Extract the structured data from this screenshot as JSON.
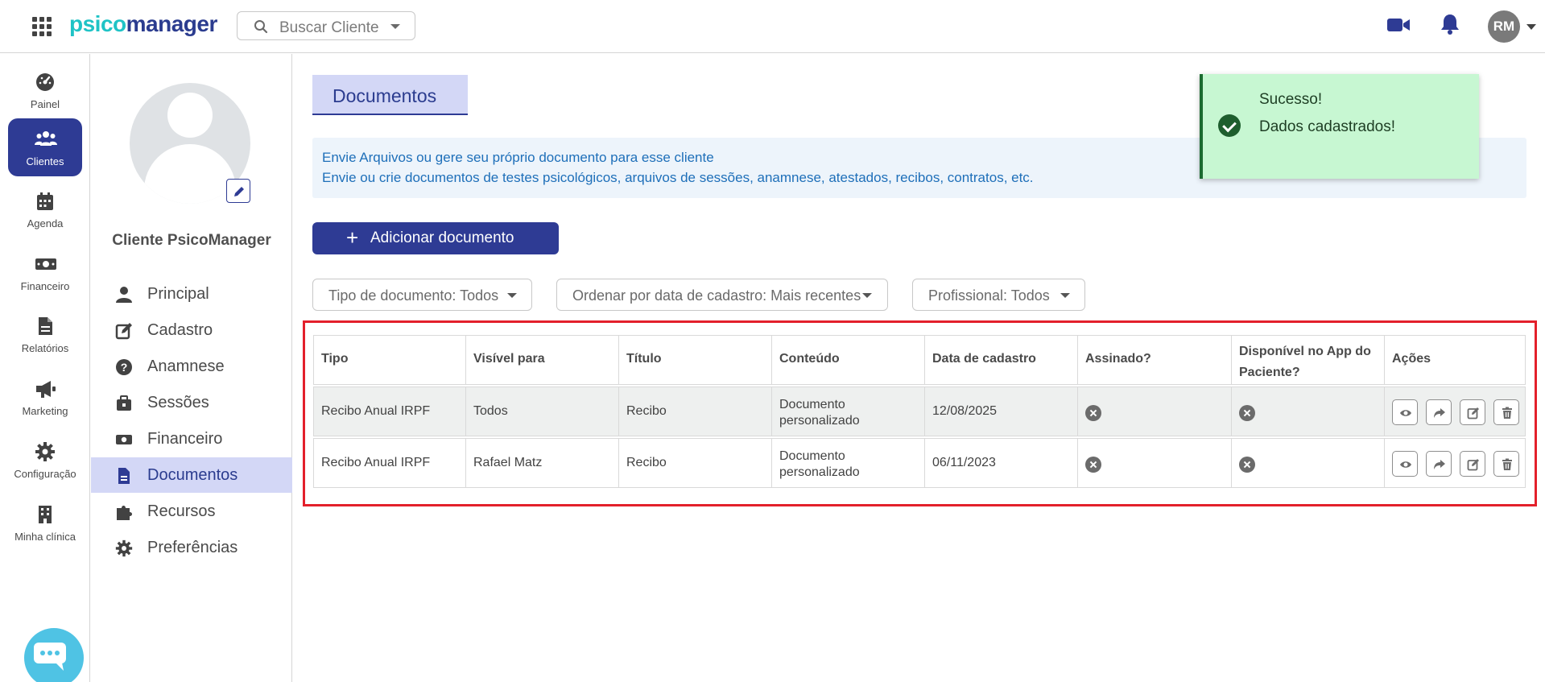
{
  "header": {
    "logo_part1": "psico",
    "logo_part2": "manager",
    "search_placeholder": "Buscar Cliente",
    "avatar_initials": "RM"
  },
  "rail": {
    "items": [
      {
        "label": "Painel",
        "icon": "dashboard-icon"
      },
      {
        "label": "Clientes",
        "icon": "users-icon",
        "active": true
      },
      {
        "label": "Agenda",
        "icon": "calendar-icon"
      },
      {
        "label": "Financeiro",
        "icon": "money-icon"
      },
      {
        "label": "Relatórios",
        "icon": "report-icon"
      },
      {
        "label": "Marketing",
        "icon": "megaphone-icon"
      },
      {
        "label": "Configuração",
        "icon": "gear-icon"
      },
      {
        "label": "Minha clínica",
        "icon": "building-icon"
      }
    ]
  },
  "client": {
    "name": "Cliente PsicoManager",
    "menu": [
      {
        "label": "Principal",
        "icon": "user-icon"
      },
      {
        "label": "Cadastro",
        "icon": "edit-icon"
      },
      {
        "label": "Anamnese",
        "icon": "question-icon"
      },
      {
        "label": "Sessões",
        "icon": "briefcase-icon"
      },
      {
        "label": "Financeiro",
        "icon": "money-icon"
      },
      {
        "label": "Documentos",
        "icon": "document-icon",
        "active": true
      },
      {
        "label": "Recursos",
        "icon": "puzzle-icon"
      },
      {
        "label": "Preferências",
        "icon": "gear-icon"
      }
    ]
  },
  "main": {
    "title": "Documentos",
    "info_line1": "Envie Arquivos ou gere seu próprio documento para esse cliente",
    "info_line2": "Envie ou crie documentos de testes psicológicos, arquivos de sessões, anamnese, atestados, recibos, contratos, etc.",
    "add_button": "Adicionar documento",
    "filters": {
      "tipo": "Tipo de documento: Todos",
      "ordenar": "Ordenar por data de cadastro: Mais recentes",
      "profissional": "Profissional: Todos"
    }
  },
  "table": {
    "columns": [
      "Tipo",
      "Visível para",
      "Título",
      "Conteúdo",
      "Data de cadastro",
      "Assinado?",
      "Disponível no App do Paciente?",
      "Ações"
    ],
    "rows": [
      {
        "tipo": "Recibo Anual IRPF",
        "visivel": "Todos",
        "titulo": "Recibo",
        "conteudo": "Documento personalizado",
        "data": "12/08/2025",
        "assinado": false,
        "disponivel": false
      },
      {
        "tipo": "Recibo Anual IRPF",
        "visivel": "Rafael Matz",
        "titulo": "Recibo",
        "conteudo": "Documento personalizado",
        "data": "06/11/2023",
        "assinado": false,
        "disponivel": false
      }
    ]
  },
  "toast": {
    "title": "Sucesso!",
    "message": "Dados cadastrados!"
  },
  "colors": {
    "primary": "#2e3b94",
    "brand_teal": "#1fc3c6",
    "active_bg": "#d3d7f6",
    "highlight": "#e3202b",
    "toast_bg": "#c7f7d2"
  }
}
